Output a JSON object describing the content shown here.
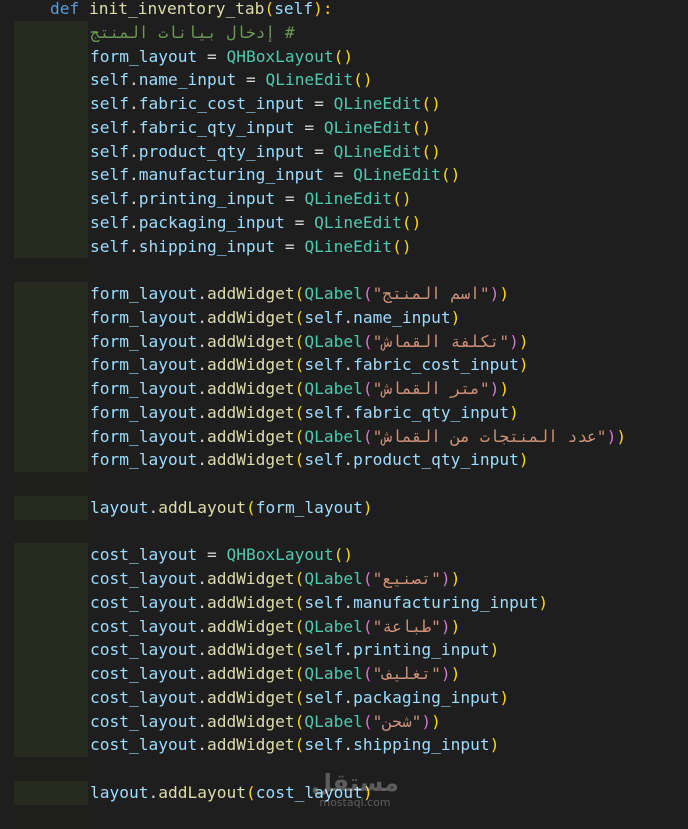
{
  "editor": {
    "def_line": {
      "keyword": "def",
      "name": "init_inventory_tab",
      "open": "(",
      "param": "self",
      "close": "):"
    },
    "comment": "# إدخال بيانات المنتج",
    "form_layout_decl": {
      "var": "form_layout",
      "op": " = ",
      "cls": "QHBoxLayout",
      "parens": "()"
    },
    "inputs": [
      {
        "name": "name_input"
      },
      {
        "name": "fabric_cost_input"
      },
      {
        "name": "fabric_qty_input"
      },
      {
        "name": "product_qty_input"
      },
      {
        "name": "manufacturing_input"
      },
      {
        "name": "printing_input"
      },
      {
        "name": "packaging_input"
      },
      {
        "name": "shipping_input"
      }
    ],
    "qlineedit": "QLineEdit",
    "self_kw": "self",
    "form_widgets": [
      {
        "kind": "label",
        "text": "\"اسم المنتج\""
      },
      {
        "kind": "input",
        "attr": "name_input"
      },
      {
        "kind": "label",
        "text": "\"تكلفة القماش\""
      },
      {
        "kind": "input",
        "attr": "fabric_cost_input"
      },
      {
        "kind": "label",
        "text": "\"متر القماش\""
      },
      {
        "kind": "input",
        "attr": "fabric_qty_input"
      },
      {
        "kind": "label",
        "text": "\"عدد المنتجات من القماش\""
      },
      {
        "kind": "input",
        "attr": "product_qty_input"
      }
    ],
    "add_widget": "addWidget",
    "add_layout": "addLayout",
    "qlabel": "QLabel",
    "layout_var": "layout",
    "cost_layout_decl": {
      "var": "cost_layout",
      "op": " = ",
      "cls": "QHBoxLayout",
      "parens": "()"
    },
    "cost_widgets": [
      {
        "kind": "label",
        "text": "\"تصنيع\""
      },
      {
        "kind": "input",
        "attr": "manufacturing_input"
      },
      {
        "kind": "label",
        "text": "\"طباعة\""
      },
      {
        "kind": "input",
        "attr": "printing_input"
      },
      {
        "kind": "label",
        "text": "\"تغليف\""
      },
      {
        "kind": "input",
        "attr": "packaging_input"
      },
      {
        "kind": "label",
        "text": "\"شحن\""
      },
      {
        "kind": "input",
        "attr": "shipping_input"
      }
    ],
    "form_layout_name": "form_layout",
    "cost_layout_name": "cost_layout"
  },
  "watermark": {
    "logo": "مستقل",
    "site": "mostaql.com"
  },
  "colors": {
    "background": "#1e1e1e",
    "keyword": "#569cd6",
    "function": "#dcdcaa",
    "variable": "#9cdcfe",
    "class": "#4ec9b0",
    "string": "#ce9178",
    "comment": "#6a9955",
    "bracket1": "#ffd700",
    "bracket2": "#da70d6"
  }
}
